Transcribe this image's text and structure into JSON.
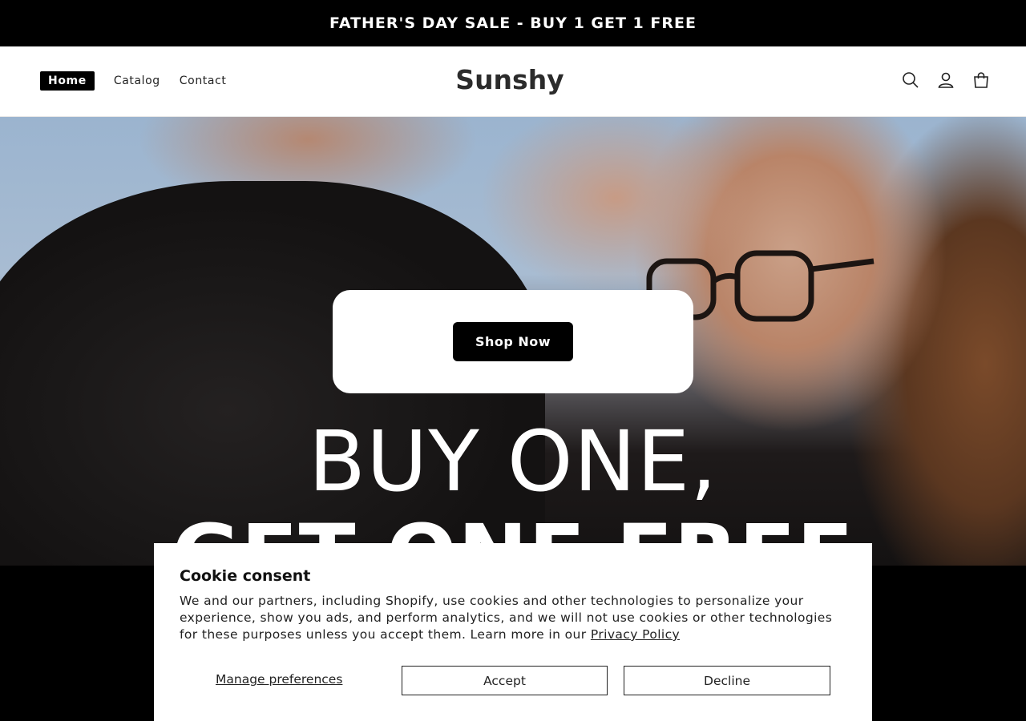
{
  "announcement": {
    "text": "FATHER'S DAY SALE - BUY 1 GET 1 FREE"
  },
  "header": {
    "nav": [
      {
        "label": "Home",
        "active": true
      },
      {
        "label": "Catalog",
        "active": false
      },
      {
        "label": "Contact",
        "active": false
      }
    ],
    "logo": "Sunshy",
    "icons": [
      "search-icon",
      "account-icon",
      "cart-icon"
    ]
  },
  "hero": {
    "button_label": "Shop Now",
    "headline_line1": "BUY ONE,",
    "headline_line2": "GET ONE FREE"
  },
  "cookie_banner": {
    "title": "Cookie consent",
    "text": "We and our partners, including Shopify, use cookies and other technologies to personalize your experience, show you ads, and perform analytics, and we will not use cookies or other technologies for these purposes unless you accept them. Learn more in our ",
    "privacy_link": "Privacy Policy",
    "manage_label": "Manage preferences",
    "accept_label": "Accept",
    "decline_label": "Decline"
  },
  "colors": {
    "accent": "#000000",
    "background": "#ffffff"
  }
}
